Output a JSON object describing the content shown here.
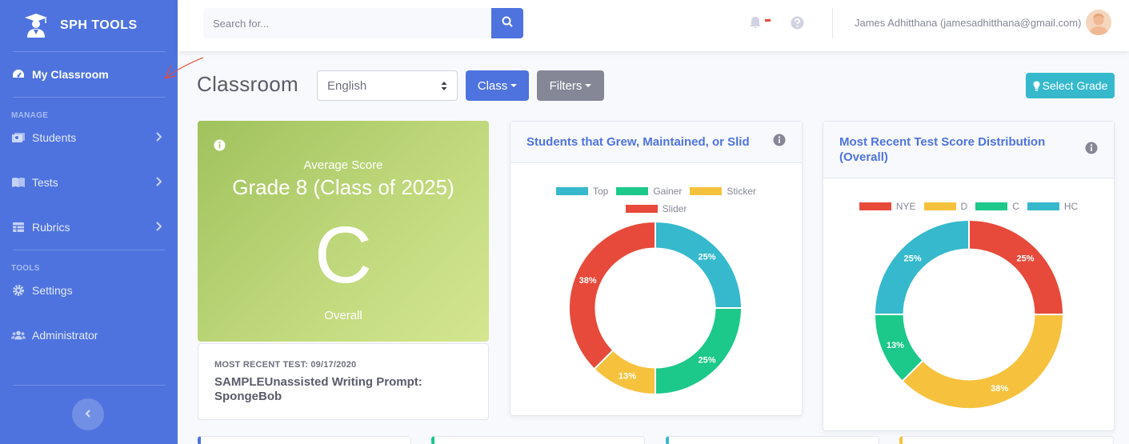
{
  "sidebar": {
    "brand": "SPH TOOLS",
    "active_item": "My Classroom",
    "manage_heading": "MANAGE",
    "manage_items": [
      {
        "label": "Students",
        "icon": "user-card-icon"
      },
      {
        "label": "Tests",
        "icon": "book-icon"
      },
      {
        "label": "Rubrics",
        "icon": "table-icon"
      }
    ],
    "tools_heading": "TOOLS",
    "tools_items": [
      {
        "label": "Settings",
        "icon": "gear-icon"
      },
      {
        "label": "Administrator",
        "icon": "users-icon"
      }
    ]
  },
  "topbar": {
    "search_placeholder": "Search for...",
    "user_name": "James Adhitthana (jamesadhitthana@gmail.com)"
  },
  "heading": {
    "title": "Classroom",
    "language_value": "English",
    "class_button": "Class",
    "filters_button": "Filters",
    "select_grade_button": "Select Grade"
  },
  "score_card": {
    "label": "Average Score",
    "grade": "Grade 8 (Class of 2025)",
    "score": "C",
    "scope": "Overall"
  },
  "recent_test": {
    "label": "MOST RECENT TEST: 09/17/2020",
    "name": "SAMPLEUnassisted Writing Prompt: SpongeBob"
  },
  "charts": {
    "growth": {
      "title": "Students that Grew, Maintained, or Slid",
      "legend": [
        {
          "name": "Top",
          "color": "#36b9cc"
        },
        {
          "name": "Gainer",
          "color": "#1cc88a"
        },
        {
          "name": "Sticker",
          "color": "#f6c23e"
        },
        {
          "name": "Slider",
          "color": "#e74a3b"
        }
      ]
    },
    "distribution": {
      "title": "Most Recent Test Score Distribution (Overall)",
      "legend": [
        {
          "name": "NYE",
          "color": "#e74a3b"
        },
        {
          "name": "D",
          "color": "#f6c23e"
        },
        {
          "name": "C",
          "color": "#1cc88a"
        },
        {
          "name": "HC",
          "color": "#36b9cc"
        }
      ]
    }
  },
  "chart_data": [
    {
      "type": "pie",
      "title": "Students that Grew, Maintained, or Slid",
      "categories": [
        "Top",
        "Gainer",
        "Sticker",
        "Slider"
      ],
      "values": [
        25,
        25,
        12.5,
        37.5
      ],
      "labels": [
        "25%",
        "25%",
        "13%",
        "38%"
      ],
      "colors": [
        "#36b9cc",
        "#1cc88a",
        "#f6c23e",
        "#e74a3b"
      ],
      "legend": "top"
    },
    {
      "type": "pie",
      "title": "Most Recent Test Score Distribution (Overall)",
      "categories": [
        "NYE",
        "D",
        "C",
        "HC"
      ],
      "values": [
        25,
        37.5,
        12.5,
        25
      ],
      "labels": [
        "25%",
        "38%",
        "13%",
        "25%"
      ],
      "colors": [
        "#e74a3b",
        "#f6c23e",
        "#1cc88a",
        "#36b9cc"
      ],
      "legend": "top"
    }
  ]
}
